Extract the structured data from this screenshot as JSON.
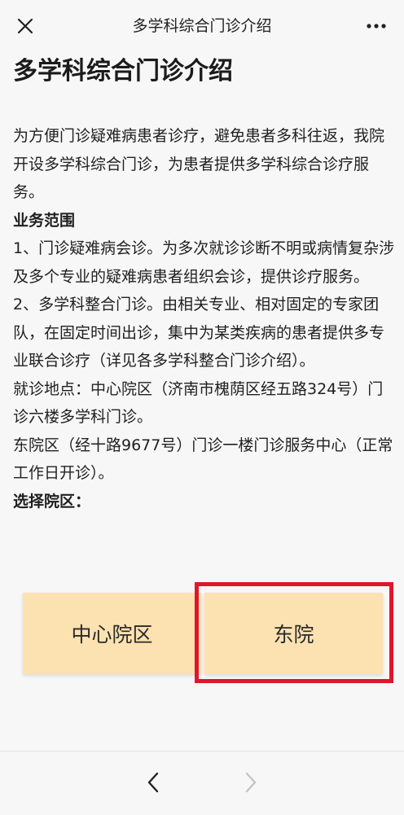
{
  "nav": {
    "title": "多学科综合门诊介绍",
    "close_icon": "close-icon",
    "more_icon": "more-icon"
  },
  "article": {
    "title": "多学科综合门诊介绍",
    "intro": "为方便门诊疑难病患者诊疗，避免患者多科往返，我院开设多学科综合门诊，为患者提供多学科综合诊疗服务。",
    "scope_heading": "业务范围",
    "scope_item_1": "1、门诊疑难病会诊。为多次就诊诊断不明或病情复杂涉及多个专业的疑难病患者组织会诊，提供诊疗服务。",
    "scope_item_2": "2、多学科整合门诊。由相关专业、相对固定的专家团队，在固定时间出诊，集中为某类疾病的患者提供多专业联合诊疗（详见各多学科整合门诊介绍）。",
    "location_central": "就诊地点：中心院区（济南市槐荫区经五路324号）门诊六楼多学科门诊。",
    "location_east": "东院区（经十路9677号）门诊一楼门诊服务中心（正常工作日开诊）。",
    "select_label": "选择院区："
  },
  "campus": {
    "central_label": "中心院区",
    "east_label": "东院"
  },
  "colors": {
    "button_bg": "#fde2b1",
    "highlight": "#e0162b",
    "background": "#f7f7f7"
  },
  "bottom_nav": {
    "back_icon": "back-arrow-icon",
    "forward_icon": "forward-arrow-icon"
  }
}
